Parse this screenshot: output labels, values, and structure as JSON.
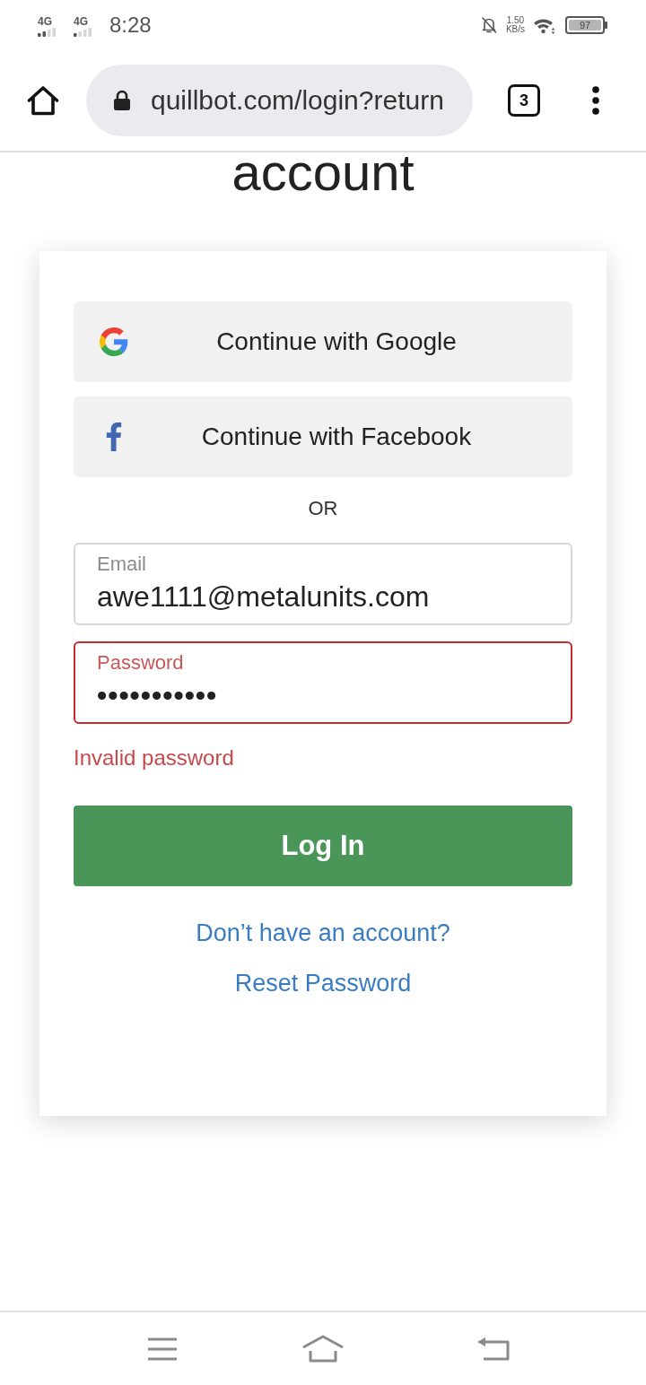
{
  "status_bar": {
    "networks": [
      "4G",
      "4G"
    ],
    "time": "8:28",
    "net_speed": [
      "1.50",
      "KB/s"
    ],
    "battery": "97"
  },
  "browser_toolbar": {
    "url": "quillbot.com/login?return",
    "tab_count": "3"
  },
  "page": {
    "heading": "account"
  },
  "login_card": {
    "social_buttons": [
      {
        "kind": "google",
        "label": "Continue with Google"
      },
      {
        "kind": "facebook",
        "label": "Continue with Facebook"
      }
    ],
    "separator": "OR",
    "fields": [
      {
        "kind": "email",
        "label": "Email",
        "value": "awe1111@metalunits.com",
        "error": false
      },
      {
        "kind": "password",
        "label": "Password",
        "value": "•••••••••••",
        "error": true
      }
    ],
    "error_message": "Invalid password",
    "submit_button": "Log In",
    "links": [
      "Don’t have an account?",
      "Reset Password"
    ]
  }
}
